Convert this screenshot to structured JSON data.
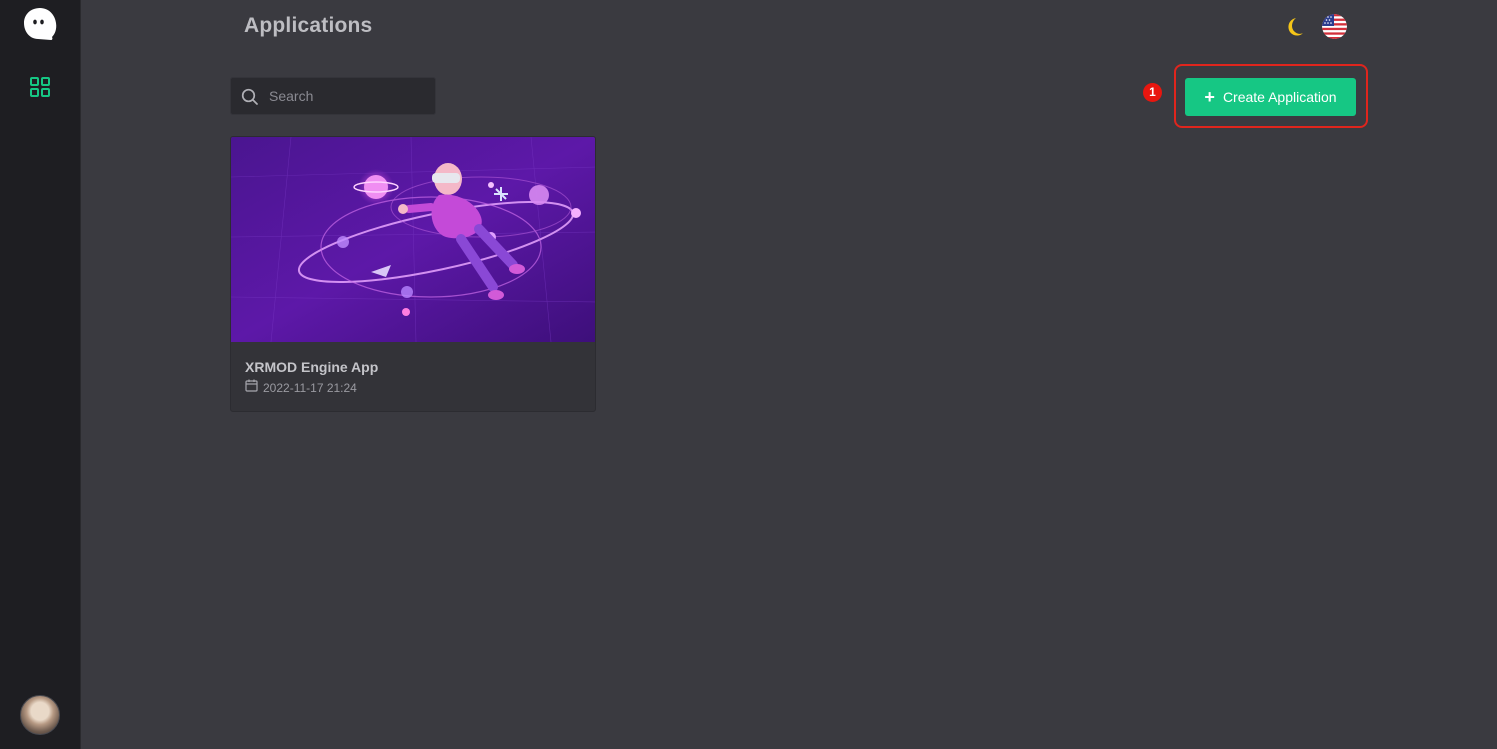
{
  "header": {
    "title": "Applications"
  },
  "search": {
    "placeholder": "Search"
  },
  "toolbar": {
    "step_badge": "1",
    "create_label": "Create Application"
  },
  "apps": [
    {
      "name": "XRMOD Engine App",
      "date": "2022-11-17 21:24"
    }
  ],
  "icons": {
    "logo": "ghost-logo-icon",
    "nav": "grid-icon",
    "theme": "moon-icon",
    "language": "us-flag-icon",
    "search": "search-icon",
    "date": "calendar-icon"
  },
  "colors": {
    "accent": "#16c784",
    "highlight": "#e0251d",
    "moon": "#f5c518",
    "background": "#3a3a40",
    "sidebar": "#1e1e22"
  }
}
